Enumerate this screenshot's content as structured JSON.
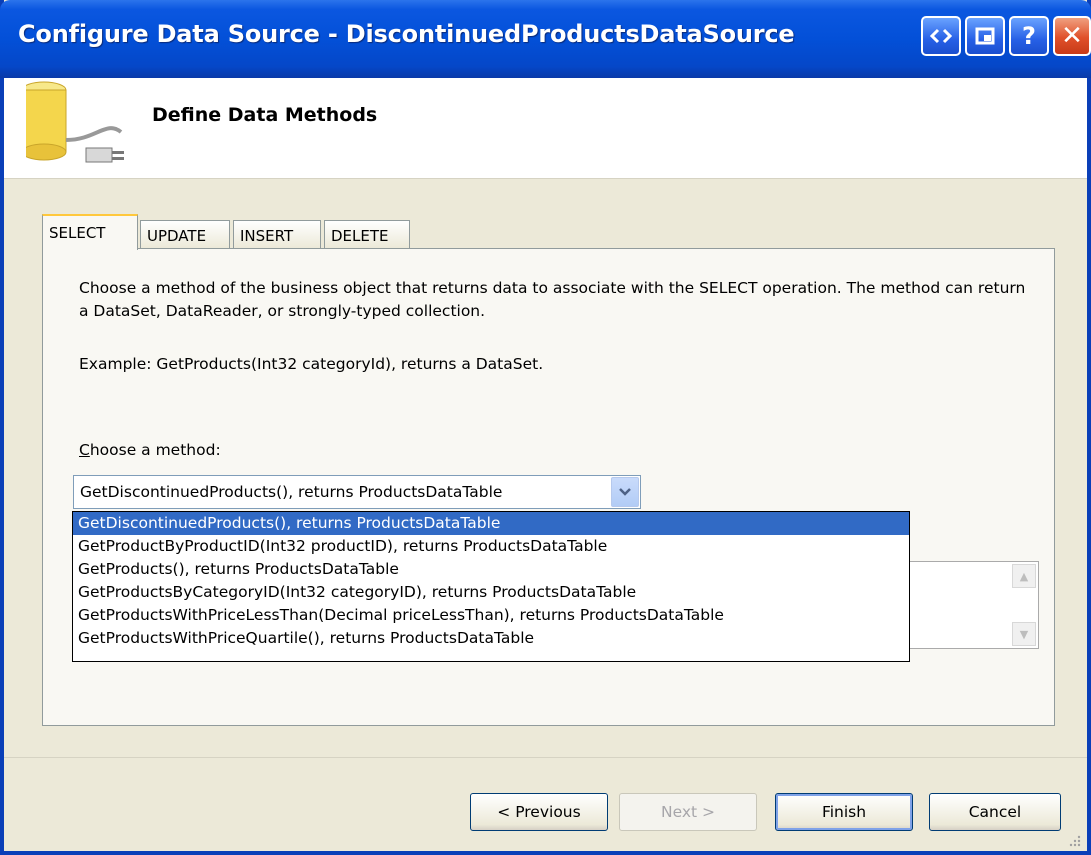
{
  "window": {
    "title": "Configure Data Source - DiscontinuedProductsDataSource",
    "buttons": [
      "restore-icon",
      "minimize-to-tray-icon",
      "help-icon",
      "close-icon"
    ]
  },
  "header": {
    "title": "Define Data Methods",
    "icon": "database-connection-icon"
  },
  "tabs": [
    {
      "label": "SELECT",
      "active": true
    },
    {
      "label": "UPDATE",
      "active": false
    },
    {
      "label": "INSERT",
      "active": false
    },
    {
      "label": "DELETE",
      "active": false
    }
  ],
  "panel": {
    "description": "Choose a method of the business object that returns data to associate with the SELECT operation. The method can return a DataSet, DataReader, or strongly-typed collection.",
    "example": "Example: GetProducts(Int32 categoryId), returns a DataSet.",
    "choose_label_first": "C",
    "choose_label_rest": "hoose a method:",
    "method_value": "GetDiscontinuedProducts(), returns ProductsDataTable"
  },
  "dropdown": {
    "items": [
      "GetDiscontinuedProducts(), returns ProductsDataTable",
      "GetProductByProductID(Int32 productID), returns ProductsDataTable",
      "GetProducts(), returns ProductsDataTable",
      "GetProductsByCategoryID(Int32 categoryID), returns ProductsDataTable",
      "GetProductsWithPriceLessThan(Decimal priceLessThan), returns ProductsDataTable",
      "GetProductsWithPriceQuartile(), returns ProductsDataTable"
    ],
    "selected_index": 0
  },
  "footer": {
    "previous_label": "< Previous",
    "next_label": "Next >",
    "finish_label": "Finish",
    "cancel_label": "Cancel"
  },
  "colors": {
    "titlebar": "#0350d8",
    "selection": "#316ac5",
    "dialog_bg": "#ece9d8"
  }
}
